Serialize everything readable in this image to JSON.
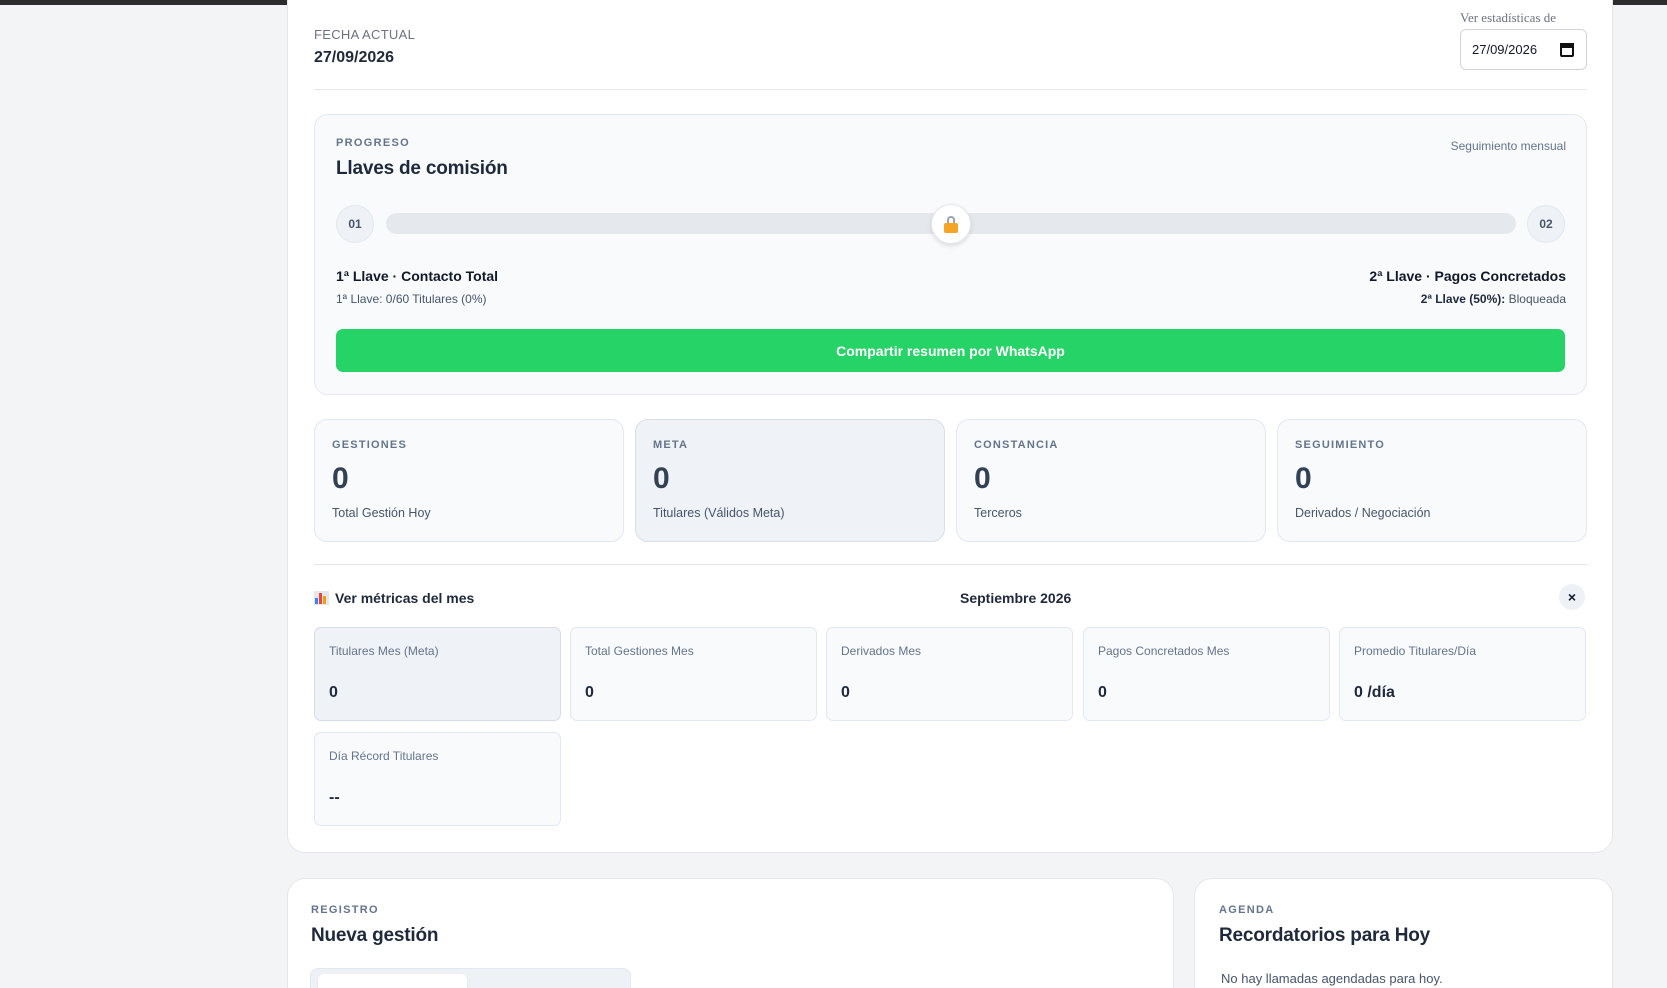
{
  "header": {
    "fecha_label": "FECHA ACTUAL",
    "fecha_value": "27/09/2026",
    "stats_label": "Ver estadísticas de",
    "stats_date": "27/09/2026"
  },
  "progreso": {
    "eyebrow": "PROGRESO",
    "title": "Llaves de comisión",
    "tracking": "Seguimiento mensual",
    "step1": "01",
    "step2": "02",
    "llave1_title": "1ª Llave · Contacto Total",
    "llave1_detail": "1ª Llave: 0/60 Titulares (0%)",
    "llave2_title": "2ª Llave · Pagos Concretados",
    "llave2_detail_strong": "2ª Llave (50%):",
    "llave2_detail_status": "Bloqueada",
    "progress_fraction": 0.5,
    "whatsapp_button": "Compartir resumen por WhatsApp",
    "whatsapp_color": "#25d366"
  },
  "kpis": [
    {
      "eyebrow": "GESTIONES",
      "value": "0",
      "label": "Total Gestión Hoy"
    },
    {
      "eyebrow": "META",
      "value": "0",
      "label": "Titulares (Válidos Meta)"
    },
    {
      "eyebrow": "CONSTANCIA",
      "value": "0",
      "label": "Terceros"
    },
    {
      "eyebrow": "SEGUIMIENTO",
      "value": "0",
      "label": "Derivados / Negociación"
    }
  ],
  "metrics": {
    "title": "Ver métricas del mes",
    "month": "Septiembre 2026",
    "close": "×",
    "cards": [
      {
        "label": "Titulares Mes (Meta)",
        "value": "0"
      },
      {
        "label": "Total Gestiones Mes",
        "value": "0"
      },
      {
        "label": "Derivados Mes",
        "value": "0"
      },
      {
        "label": "Pagos Concretados Mes",
        "value": "0"
      },
      {
        "label": "Promedio Titulares/Día",
        "value": "0 /día"
      },
      {
        "label": "Día Récord Titulares",
        "value": "--"
      }
    ]
  },
  "registro": {
    "eyebrow": "REGISTRO",
    "title": "Nueva gestión"
  },
  "agenda": {
    "eyebrow": "AGENDA",
    "title": "Recordatorios para Hoy",
    "empty": "No hay llamadas agendadas para hoy."
  }
}
